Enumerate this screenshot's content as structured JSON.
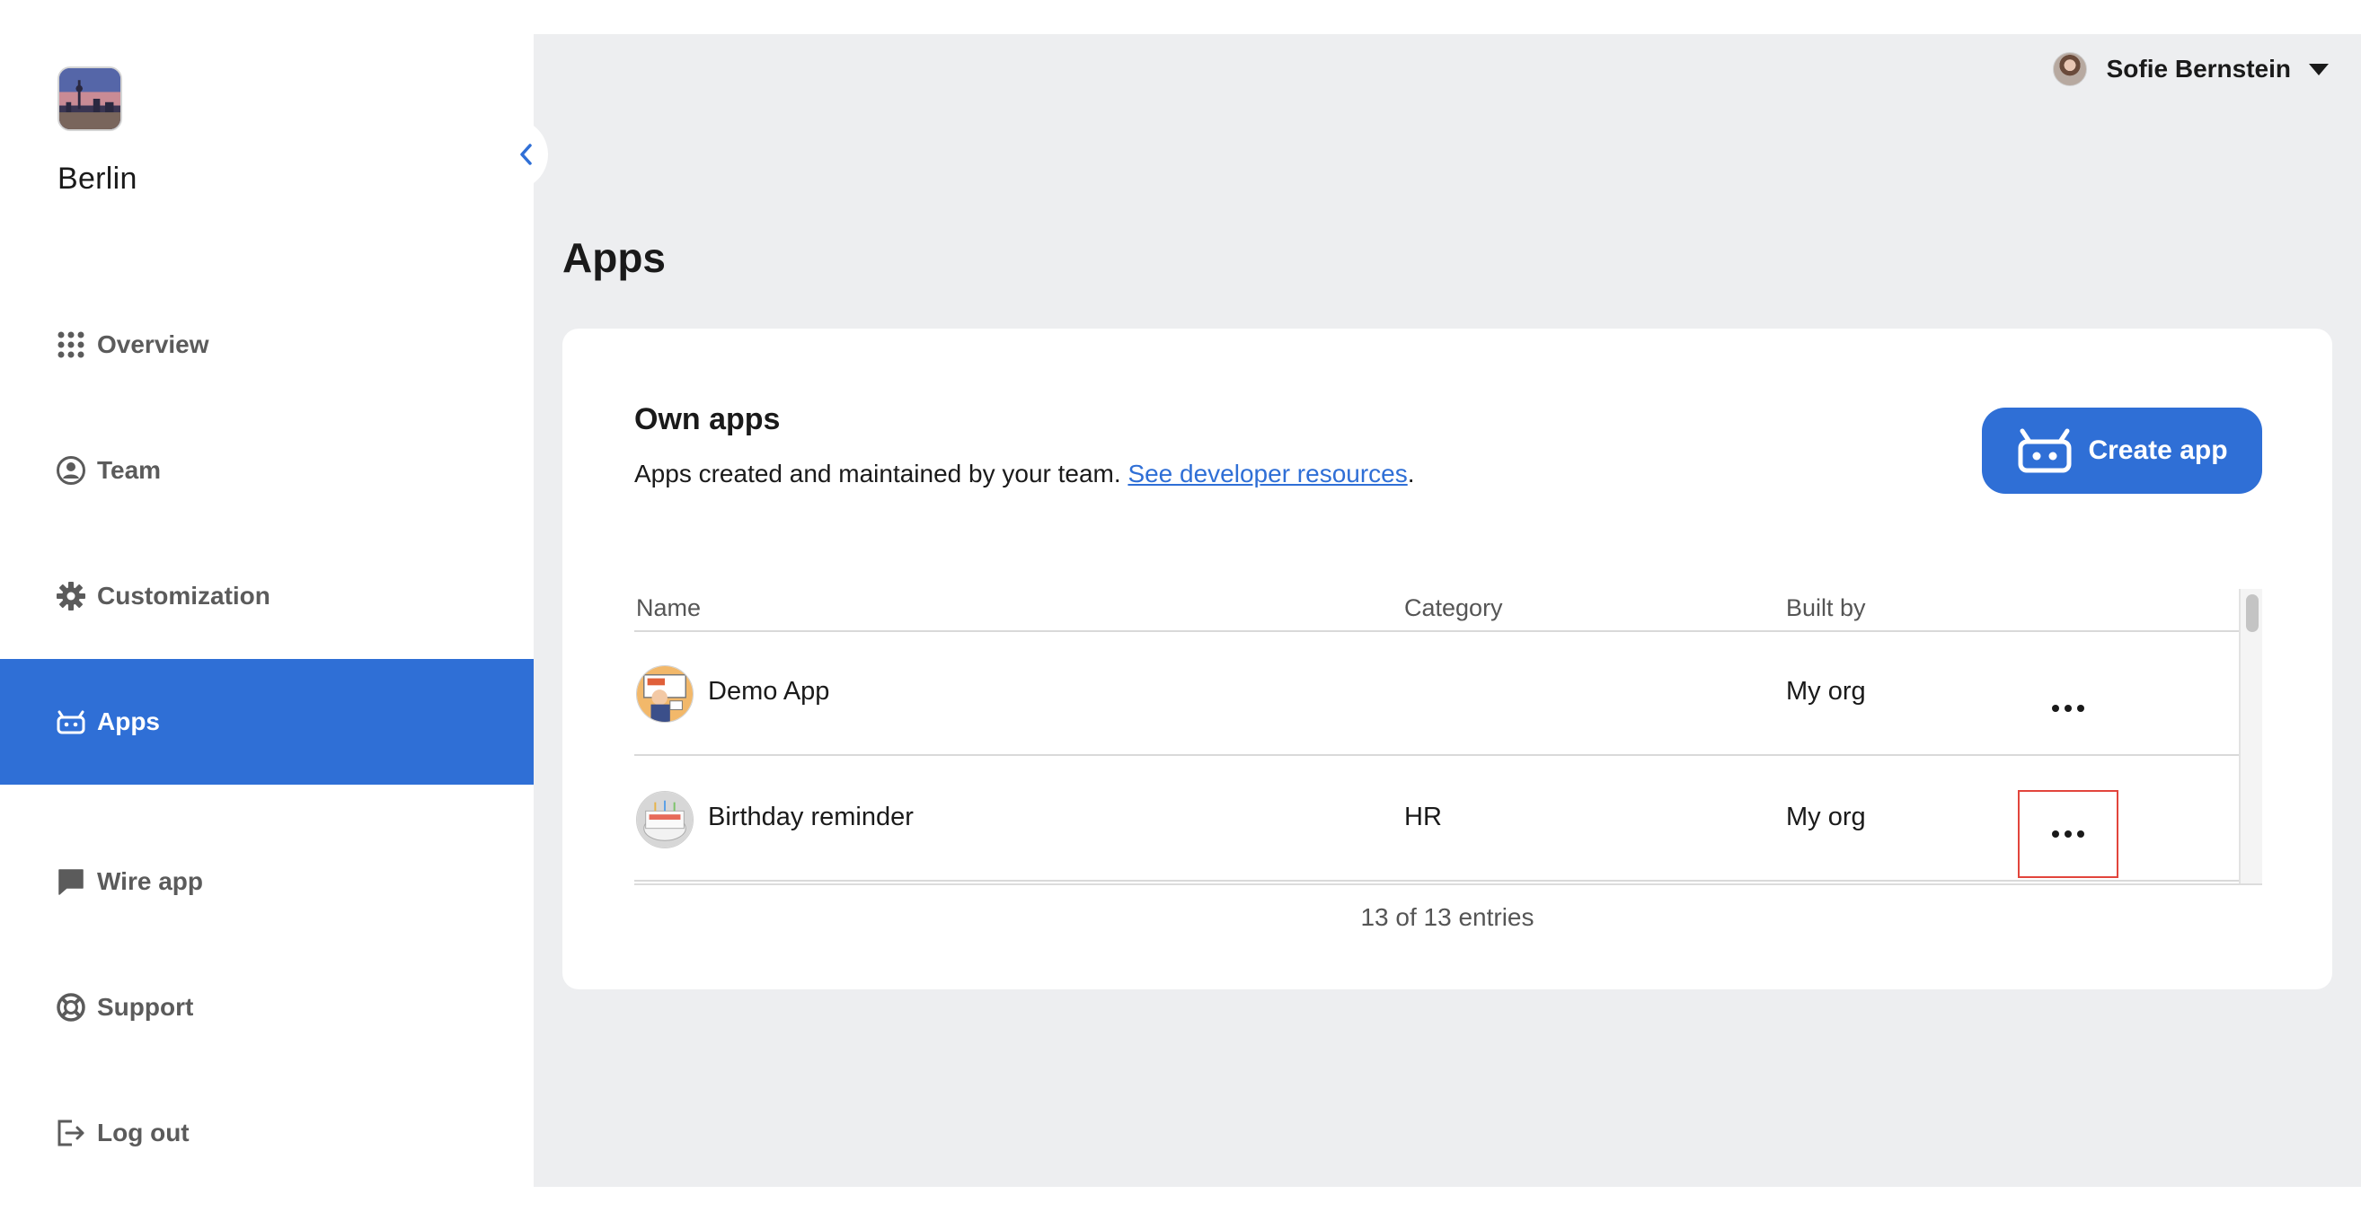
{
  "team": {
    "name": "Berlin"
  },
  "sidebar": {
    "items": [
      {
        "label": "Overview",
        "icon": "grid-icon"
      },
      {
        "label": "Team",
        "icon": "user-circle-icon"
      },
      {
        "label": "Customization",
        "icon": "gear-icon"
      },
      {
        "label": "Apps",
        "icon": "robot-icon",
        "active": true
      },
      {
        "label": "Wire app",
        "icon": "chat-bubble-icon"
      },
      {
        "label": "Support",
        "icon": "lifebuoy-icon"
      },
      {
        "label": "Log out",
        "icon": "logout-icon"
      }
    ]
  },
  "header": {
    "user_name": "Sofie Bernstein"
  },
  "page": {
    "title": "Apps"
  },
  "own_apps": {
    "title": "Own apps",
    "description": "Apps created and maintained by your team.",
    "link_text": "See developer resources",
    "link_suffix": ".",
    "create_button": "Create app"
  },
  "table": {
    "columns": [
      "Name",
      "Category",
      "Built by"
    ],
    "rows": [
      {
        "name": "Demo App",
        "category": "",
        "built_by": "My org"
      },
      {
        "name": "Birthday reminder",
        "category": "HR",
        "built_by": "My org"
      }
    ],
    "entries_text": "13 of 13 entries"
  },
  "colors": {
    "accent": "#2f6fd6",
    "background": "#edeef0",
    "highlight": "#e2453c"
  }
}
